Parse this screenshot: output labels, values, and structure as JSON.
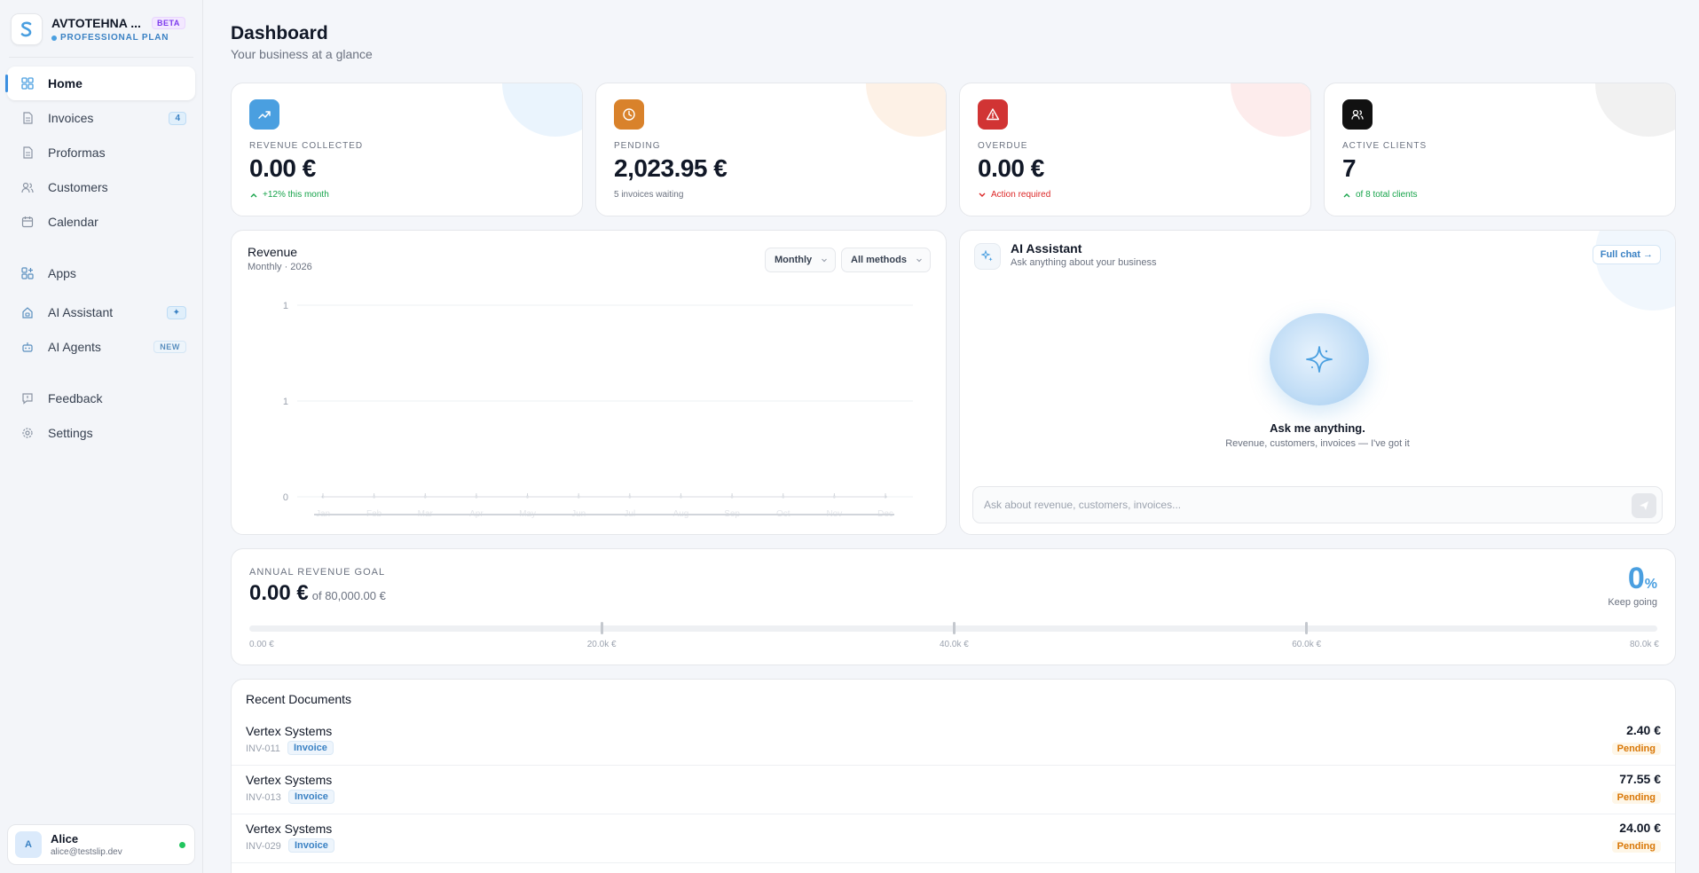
{
  "brand": {
    "name": "AVTOTEHNA ...",
    "badge": "BETA",
    "plan": "PROFESSIONAL PLAN"
  },
  "nav": {
    "items": [
      {
        "label": "Home",
        "icon": "grid-icon"
      },
      {
        "label": "Invoices",
        "icon": "document-icon",
        "badge": "4"
      },
      {
        "label": "Proformas",
        "icon": "document-icon"
      },
      {
        "label": "Customers",
        "icon": "users-icon"
      },
      {
        "label": "Calendar",
        "icon": "calendar-icon"
      },
      {
        "label": "Apps",
        "icon": "apps-icon"
      },
      {
        "label": "AI Assistant",
        "icon": "home-bot-icon",
        "badge": "✦"
      },
      {
        "label": "AI Agents",
        "icon": "robot-icon",
        "badge": "NEW"
      },
      {
        "label": "Feedback",
        "icon": "message-icon"
      },
      {
        "label": "Settings",
        "icon": "gear-icon"
      }
    ]
  },
  "user": {
    "initial": "A",
    "name": "Alice",
    "email": "alice@testslip.dev"
  },
  "header": {
    "title": "Dashboard",
    "subtitle": "Your business at a glance"
  },
  "kpis": [
    {
      "label": "REVENUE COLLECTED",
      "value": "0.00 €",
      "note": "+12% this month",
      "color": "#4a9fe0",
      "note_color": "#16a34a"
    },
    {
      "label": "PENDING",
      "value": "2,023.95 €",
      "note": "5 invoices waiting",
      "color": "#d9822b",
      "note_color": "#6b7280"
    },
    {
      "label": "OVERDUE",
      "value": "0.00 €",
      "note": "Action required",
      "color": "#d13434",
      "note_color": "#dc2626"
    },
    {
      "label": "ACTIVE CLIENTS",
      "value": "7",
      "note": "of 8 total clients",
      "color": "#111111",
      "note_color": "#16a34a"
    }
  ],
  "revenue": {
    "title": "Revenue",
    "subtitle": "Monthly · 2026",
    "period_select": "Monthly",
    "method_select": "All methods"
  },
  "chart_data": {
    "type": "line",
    "title": "Revenue",
    "categories": [
      "Jan",
      "Feb",
      "Mar",
      "Apr",
      "May",
      "Jun",
      "Jul",
      "Aug",
      "Sep",
      "Oct",
      "Nov",
      "Dec"
    ],
    "values": [
      0,
      0,
      0,
      0,
      0,
      0,
      0,
      0,
      0,
      0,
      0,
      0
    ],
    "y_ticks": [
      "1",
      "1",
      "0"
    ],
    "ylim": [
      0,
      1
    ],
    "grid": true
  },
  "ai": {
    "title": "AI Assistant",
    "subtitle": "Ask anything about your business",
    "full_chat": "Full chat →",
    "prompt_title": "Ask me anything.",
    "prompt_sub": "Revenue, customers, invoices — I've got it",
    "input_placeholder": "Ask about revenue, customers, invoices..."
  },
  "goal": {
    "label": "ANNUAL REVENUE GOAL",
    "current": "0.00 €",
    "target": "of 80,000.00 €",
    "percent": "0",
    "percent_sign": "%",
    "progress": 0,
    "keep": "Keep going",
    "ticks": [
      "0.00 €",
      "20.0k €",
      "40.0k €",
      "60.0k €",
      "80.0k €"
    ]
  },
  "documents": {
    "title": "Recent Documents",
    "rows": [
      {
        "name": "Vertex Systems",
        "id": "INV-011",
        "type": "Invoice",
        "amount": "2.40 €",
        "status": "Pending"
      },
      {
        "name": "Vertex Systems",
        "id": "INV-013",
        "type": "Invoice",
        "amount": "77.55 €",
        "status": "Pending"
      },
      {
        "name": "Vertex Systems",
        "id": "INV-029",
        "type": "Invoice",
        "amount": "24.00 €",
        "status": "Pending"
      }
    ]
  }
}
